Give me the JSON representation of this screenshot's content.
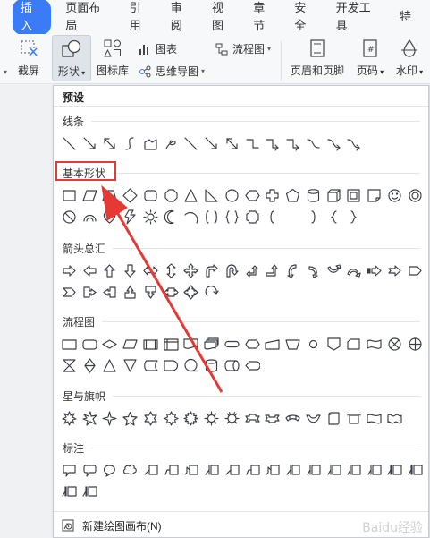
{
  "ribbon": {
    "tabs": [
      {
        "label": "插入",
        "active": true
      },
      {
        "label": "页面布局"
      },
      {
        "label": "引用"
      },
      {
        "label": "审阅"
      },
      {
        "label": "视图"
      },
      {
        "label": "章节"
      },
      {
        "label": "安全"
      },
      {
        "label": "开发工具"
      },
      {
        "label": "特"
      }
    ],
    "tools": {
      "screenshot_label": "截屏",
      "shapes_label": "形状",
      "icon_library_label": "图标库",
      "chart_label": "图表",
      "mindmap_label": "思维导图",
      "flowchart_label": "流程图",
      "header_footer_label": "页眉和页脚",
      "page_number_label": "页码",
      "watermark_label": "水印"
    },
    "accent_color": "#3b7bf6"
  },
  "panel": {
    "preset_title": "预设",
    "sections": [
      {
        "title": "线条",
        "key": "lines"
      },
      {
        "title": "基本形状",
        "key": "basic"
      },
      {
        "title": "箭头总汇",
        "key": "arrows"
      },
      {
        "title": "流程图",
        "key": "flow"
      },
      {
        "title": "星与旗帜",
        "key": "stars"
      },
      {
        "title": "标注",
        "key": "callouts"
      }
    ],
    "new_canvas_label": "新建绘图画布(N)"
  },
  "annotation": {
    "highlight_color": "#e53935"
  },
  "watermark_text": "Baidu经验"
}
